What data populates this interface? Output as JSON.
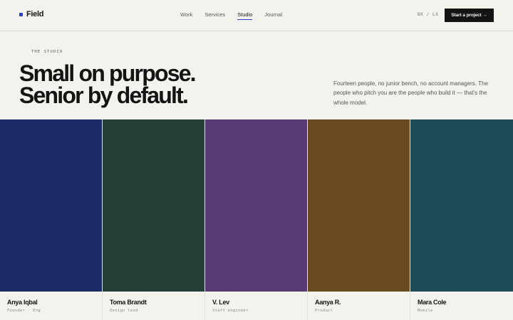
{
  "brand": {
    "name": "Field",
    "accent": "#2b3fd1"
  },
  "nav": {
    "items": [
      {
        "label": "Work"
      },
      {
        "label": "Services"
      },
      {
        "label": "Studio",
        "active": true
      },
      {
        "label": "Journal"
      }
    ]
  },
  "header": {
    "locale": "BK / LX",
    "cta_label": "Start a project →"
  },
  "hero": {
    "eyebrow": "THE STUDIO",
    "headline_line1": "Small on purpose.",
    "headline_line2": "Senior by default.",
    "intro": "Fourteen people, no junior bench, no account managers. The people who pitch you are the people who build it — that's the whole model."
  },
  "team": [
    {
      "name": "Anya Iqbal",
      "role": "Founder · Eng",
      "color": "#1e2a66"
    },
    {
      "name": "Toma Brandt",
      "role": "Design lead",
      "color": "#233f37"
    },
    {
      "name": "V. Lev",
      "role": "Staff engineer",
      "color": "#573a72"
    },
    {
      "name": "Aanya R.",
      "role": "Product",
      "color": "#6b4a1f"
    },
    {
      "name": "Mara Cole",
      "role": "Mobile",
      "color": "#1f4a58"
    }
  ]
}
